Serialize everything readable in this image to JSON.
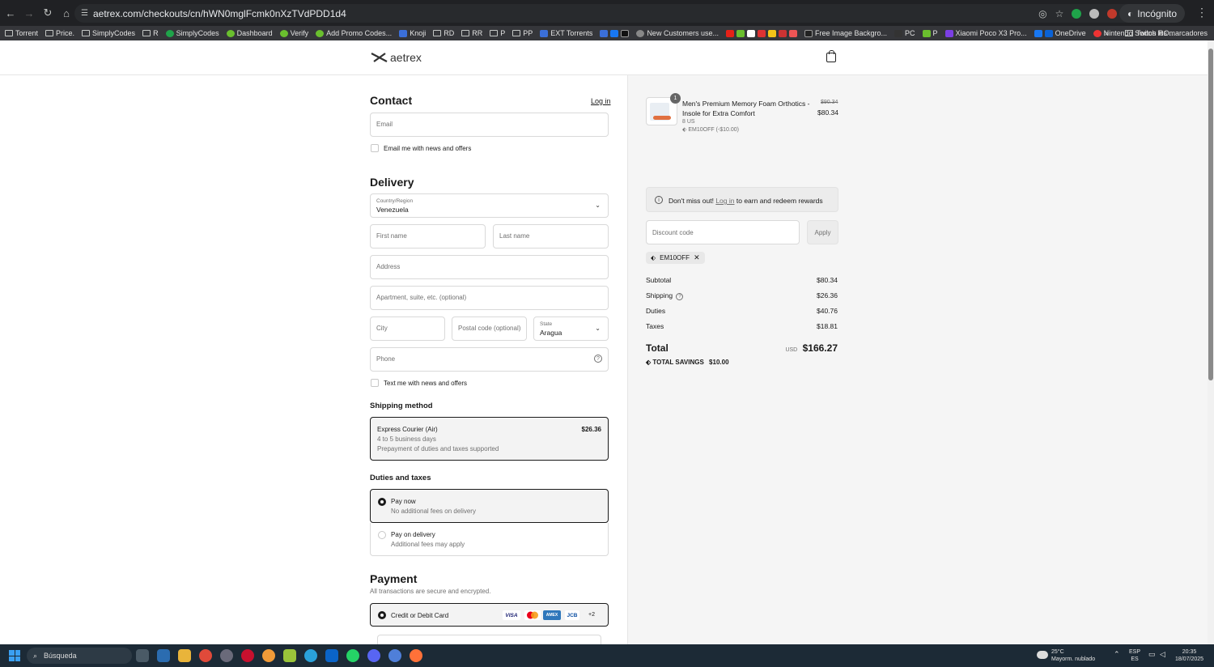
{
  "browser": {
    "url": "aetrex.com/checkouts/cn/hWN0mglFcmk0nXzTVdPDD1d4",
    "incognito_label": "Incógnito",
    "bookmarks": [
      "Torrent",
      "Price.",
      "SimplyCodes",
      "R",
      "SimplyCodes",
      "Dashboard",
      "Verify",
      "Add Promo Codes...",
      "Knoji",
      "RD",
      "RR",
      "P",
      "PP",
      "EXT Torrents",
      "New Customers use...",
      "Free Image Backgro...",
      "PC",
      "P",
      "Xiaomi Poco X3 Pro...",
      "OneDrive",
      "Nintendo Switch RO..."
    ],
    "all_bookmarks": "Todos los marcadores"
  },
  "header": {
    "logo_text": "aetrex"
  },
  "contact": {
    "title": "Contact",
    "login_link": "Log in",
    "email_placeholder": "Email",
    "news_checkbox": "Email me with news and offers"
  },
  "delivery": {
    "title": "Delivery",
    "country_label": "Country/Region",
    "country_value": "Venezuela",
    "first_name": "First name",
    "last_name": "Last name",
    "address": "Address",
    "apartment": "Apartment, suite, etc. (optional)",
    "city": "City",
    "postal": "Postal code (optional)",
    "state_label": "State",
    "state_value": "Aragua",
    "phone": "Phone",
    "text_checkbox": "Text me with news and offers"
  },
  "shipping_method": {
    "title": "Shipping method",
    "name": "Express Courier (Air)",
    "price": "$26.36",
    "eta": "4 to 5 business days",
    "note": "Prepayment of duties and taxes supported"
  },
  "duties": {
    "title": "Duties and taxes",
    "options": [
      {
        "label": "Pay now",
        "desc": "No additional fees on delivery"
      },
      {
        "label": "Pay on delivery",
        "desc": "Additional fees may apply"
      }
    ]
  },
  "payment": {
    "title": "Payment",
    "subtitle": "All transactions are secure and encrypted.",
    "method": "Credit or Debit Card",
    "cards": [
      "VISA",
      "MC",
      "AMEX",
      "JCB"
    ],
    "more": "+2"
  },
  "summary": {
    "qty_badge": "1",
    "product_name": "Men's Premium Memory Foam Orthotics - Insole for Extra Comfort",
    "variant": "8 US",
    "discount_line": "EM10OFF (-$10.00)",
    "old_price": "$90.34",
    "price": "$80.34",
    "rewards_prefix": "Don't miss out!",
    "rewards_link": "Log in",
    "rewards_suffix": "to earn and redeem rewards",
    "discount_placeholder": "Discount code",
    "apply": "Apply",
    "code_chip": "EM10OFF",
    "subtotal_label": "Subtotal",
    "subtotal": "$80.34",
    "shipping_label": "Shipping",
    "shipping": "$26.36",
    "duties_label": "Duties",
    "duties": "$40.76",
    "taxes_label": "Taxes",
    "taxes": "$18.81",
    "total_label": "Total",
    "currency": "USD",
    "total": "$166.27",
    "savings_label": "TOTAL SAVINGS",
    "savings": "$10.00"
  },
  "taskbar": {
    "search": "Búsqueda",
    "weather_temp": "25°C",
    "weather_desc": "Mayorm. nublado",
    "lang1": "ESP",
    "lang2": "ES",
    "time": "20:35",
    "date": "18/07/2025"
  }
}
